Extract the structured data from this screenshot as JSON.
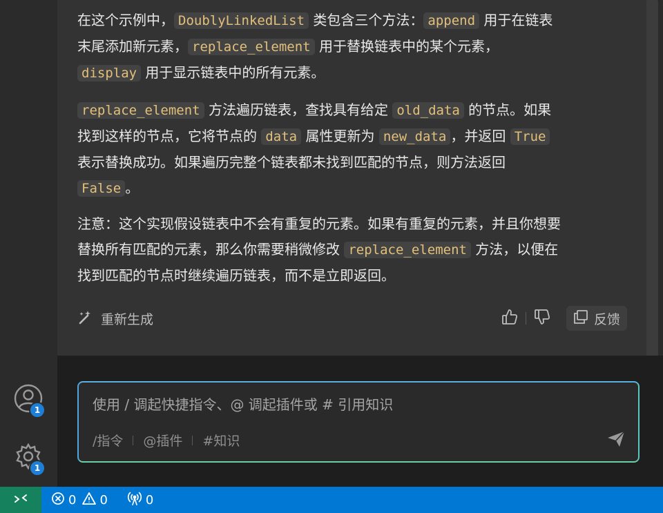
{
  "response": {
    "p1": {
      "t1": "在这个示例中，",
      "c1": "DoublyLinkedList",
      "t2": " 类包含三个方法：",
      "c2": "append",
      "t3": " 用于在链表",
      "t4": "末尾添加新元素，",
      "c3": "replace_element",
      "t5": " 用于替换链表中的某个元素，",
      "c4": "display",
      "t6": " 用于显示链表中的所有元素。"
    },
    "p2": {
      "c1": "replace_element",
      "t1": " 方法遍历链表，查找具有给定 ",
      "c2": "old_data",
      "t2": " 的节点。如果",
      "t3": "找到这样的节点，它将节点的 ",
      "c3": "data",
      "t4": " 属性更新为 ",
      "c4": "new_data",
      "t5": "，并返回 ",
      "c5": "True",
      "t6": "表示替换成功。如果遍历完整个链表都未找到匹配的节点，则方法返回",
      "c6": "False",
      "t7": "。"
    },
    "p3": {
      "t1": "注意：这个实现假设链表中不会有重复的元素。如果有重复的元素，并且你想要",
      "t2": "替换所有匹配的元素，那么你需要稍微修改 ",
      "c1": "replace_element",
      "t3": " 方法，以便在",
      "t4": "找到匹配的节点时继续遍历链表，而不是立即返回。"
    }
  },
  "actions": {
    "regenerate_label": "重新生成",
    "feedback_label": "反馈"
  },
  "input": {
    "placeholder": "使用 / 调起快捷指令、@ 调起插件或 # 引用知识",
    "shortcuts": [
      "/指令",
      "@插件",
      "#知识"
    ]
  },
  "activity_bar": {
    "account_badge": "1",
    "settings_badge": "1"
  },
  "status_bar": {
    "errors": "0",
    "warnings": "0",
    "ports": "0"
  },
  "colors": {
    "accent": "#0078d4",
    "remote": "#16825d",
    "code_text": "#e3c07a",
    "badge": "#1f7fd6"
  },
  "icons": [
    "account-icon",
    "settings-gear-icon",
    "magic-wand-icon",
    "thumbs-up-icon",
    "thumbs-down-icon",
    "feedback-icon",
    "send-icon",
    "remote-icon",
    "error-icon",
    "warning-icon",
    "broadcast-icon"
  ]
}
